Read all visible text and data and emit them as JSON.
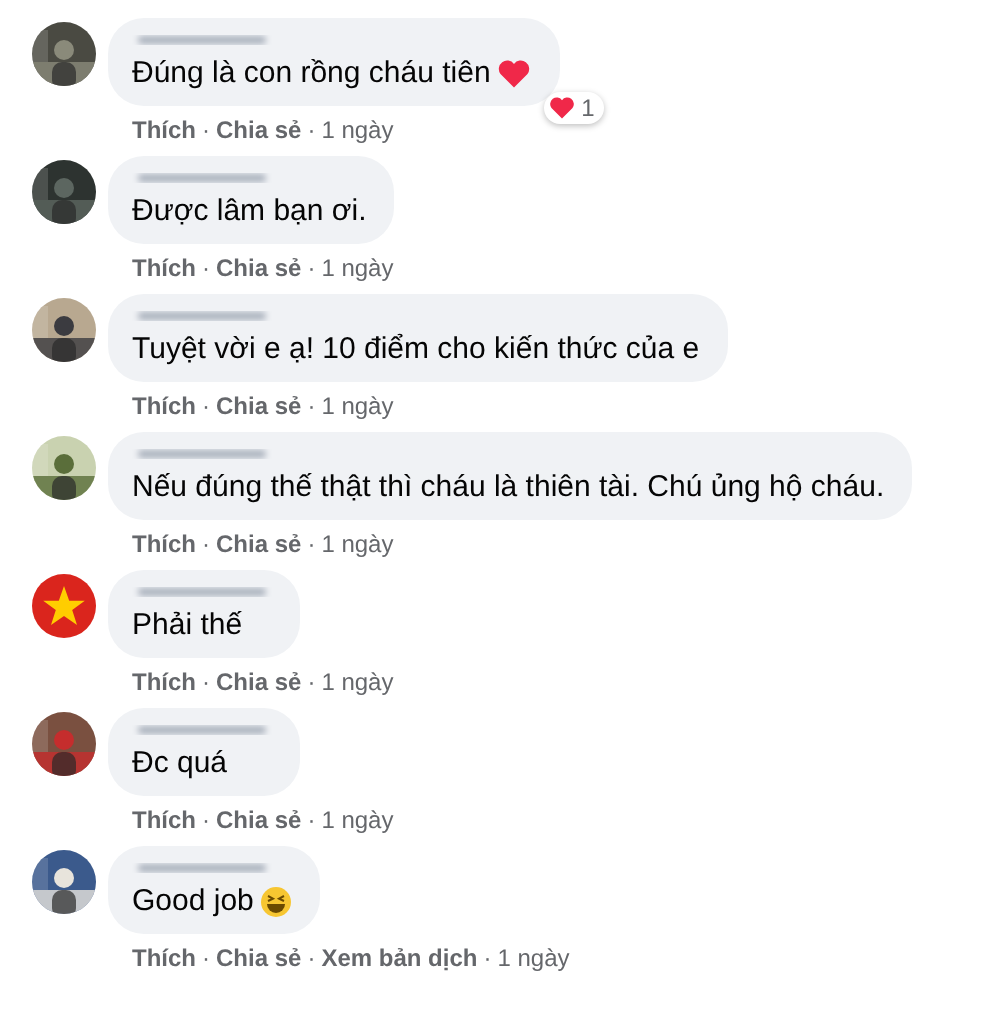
{
  "separator": "·",
  "comments": [
    {
      "text": "Đúng là con rồng cháu tiên",
      "emoji": {
        "kind": "heart"
      },
      "reaction": {
        "count": "1"
      },
      "actions": [
        {
          "label": "Thích",
          "kind": "link"
        },
        {
          "label": "Chia sẻ",
          "kind": "link"
        },
        {
          "label": "1 ngày",
          "kind": "time"
        }
      ]
    },
    {
      "text": "Được lâm bạn ơi.",
      "actions": [
        {
          "label": "Thích",
          "kind": "link"
        },
        {
          "label": "Chia sẻ",
          "kind": "link"
        },
        {
          "label": "1 ngày",
          "kind": "time"
        }
      ]
    },
    {
      "text": "Tuyệt vời e ạ! 10 điểm cho kiến thức của e",
      "actions": [
        {
          "label": "Thích",
          "kind": "link"
        },
        {
          "label": "Chia sẻ",
          "kind": "link"
        },
        {
          "label": "1 ngày",
          "kind": "time"
        }
      ]
    },
    {
      "text": "Nếu đúng thế thật thì cháu là thiên tài. Chú ủng hộ cháu.",
      "actions": [
        {
          "label": "Thích",
          "kind": "link"
        },
        {
          "label": "Chia sẻ",
          "kind": "link"
        },
        {
          "label": "1 ngày",
          "kind": "time"
        }
      ]
    },
    {
      "text": "Phải thế",
      "actions": [
        {
          "label": "Thích",
          "kind": "link"
        },
        {
          "label": "Chia sẻ",
          "kind": "link"
        },
        {
          "label": "1 ngày",
          "kind": "time"
        }
      ]
    },
    {
      "text": "Đc quá",
      "actions": [
        {
          "label": "Thích",
          "kind": "link"
        },
        {
          "label": "Chia sẻ",
          "kind": "link"
        },
        {
          "label": "1 ngày",
          "kind": "time"
        }
      ]
    },
    {
      "text": "Good job",
      "emoji": {
        "kind": "laugh"
      },
      "actions": [
        {
          "label": "Thích",
          "kind": "link"
        },
        {
          "label": "Chia sẻ",
          "kind": "link"
        },
        {
          "label": "Xem bản dịch",
          "kind": "link"
        },
        {
          "label": "1 ngày",
          "kind": "time"
        }
      ]
    }
  ]
}
